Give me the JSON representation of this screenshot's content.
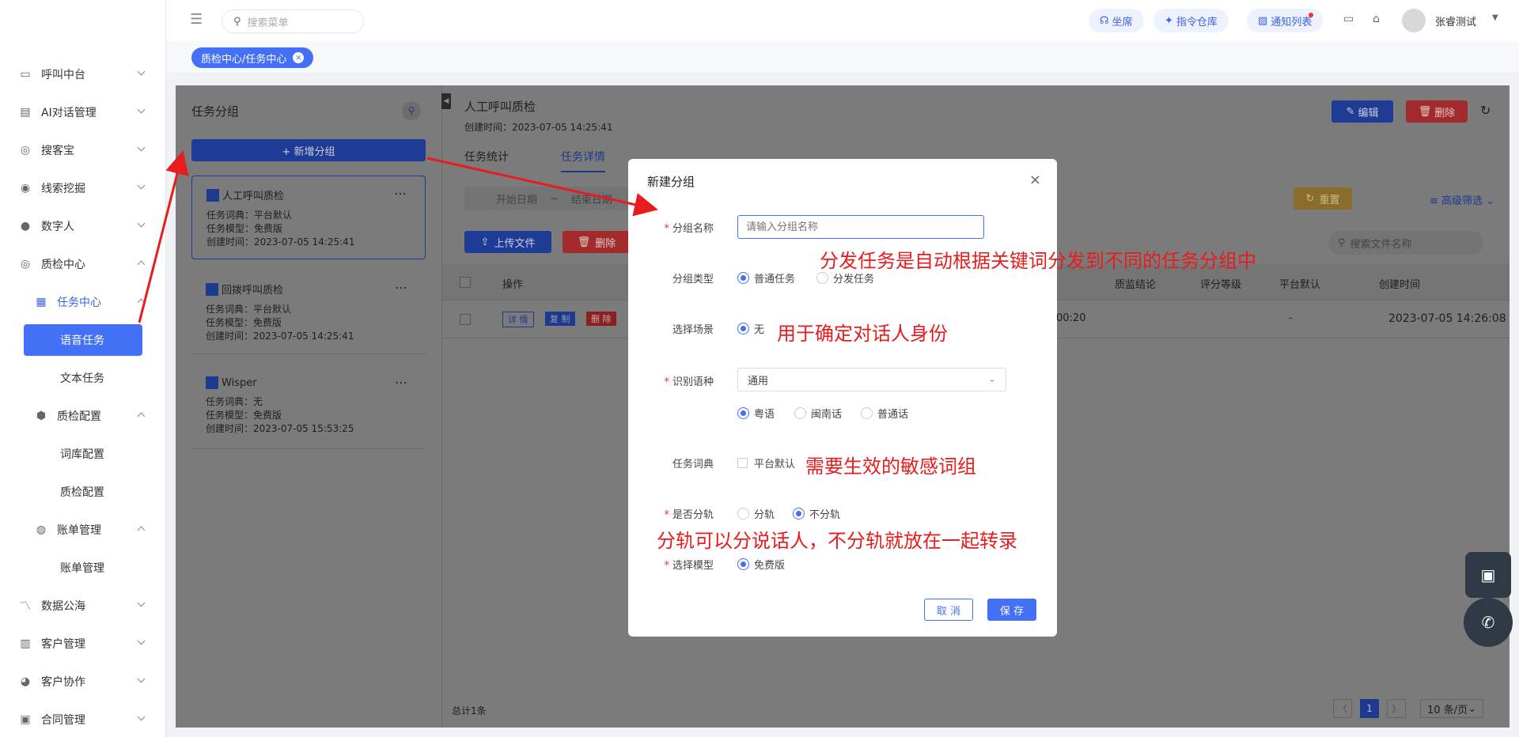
{
  "sidebar": {
    "items": [
      {
        "label": "呼叫中台",
        "icon": "monitor-icon"
      },
      {
        "label": "AI对话管理",
        "icon": "book-icon"
      },
      {
        "label": "搜客宝",
        "icon": "search-circle-icon"
      },
      {
        "label": "线索挖掘",
        "icon": "target-icon"
      },
      {
        "label": "数字人",
        "icon": "person-icon"
      },
      {
        "label": "质检中心",
        "icon": "search-circle-icon"
      },
      {
        "label": "任务中心",
        "icon": "task-icon"
      },
      {
        "label": "语音任务"
      },
      {
        "label": "文本任务"
      },
      {
        "label": "质检配置",
        "icon": "hexagon-icon"
      },
      {
        "label": "词库配置"
      },
      {
        "label": "质检配置"
      },
      {
        "label": "账单管理",
        "icon": "coin-icon"
      },
      {
        "label": "账单管理"
      },
      {
        "label": "数据公海",
        "icon": "chart-icon"
      },
      {
        "label": "客户管理",
        "icon": "customer-icon"
      },
      {
        "label": "客户协作",
        "icon": "collab-icon"
      },
      {
        "label": "合同管理",
        "icon": "contract-icon"
      }
    ]
  },
  "topbar": {
    "search_placeholder": "搜索菜单",
    "seat": "坐席",
    "command_repo": "指令仓库",
    "notify_list": "通知列表",
    "user_name": "张睿测试"
  },
  "tag": {
    "label": "质检中心/任务中心",
    "close": "×"
  },
  "group_panel": {
    "title": "任务分组",
    "add_button": "+ 新增分组",
    "cards": [
      {
        "title": "人工呼叫质检",
        "dict": "任务词典：平台默认",
        "model": "任务模型：免费版",
        "time": "创建时间：2023-07-05 14:25:41"
      },
      {
        "title": "回拨呼叫质检",
        "dict": "任务词典：平台默认",
        "model": "任务模型：免费版",
        "time": "创建时间：2023-07-05 14:25:41"
      },
      {
        "title": "Wisper",
        "dict": "任务词典：无",
        "model": "任务模型：免费版",
        "time": "创建时间：2023-07-05 15:53:25"
      }
    ]
  },
  "detail": {
    "title": "人工呼叫质检",
    "created": "创建时间：2023-07-05 14:25:41",
    "edit": "编辑",
    "delete": "删除",
    "tabs": [
      "任务统计",
      "任务详情"
    ],
    "start_date": "开始日期",
    "tilde": "~",
    "end_date": "结束日期",
    "reset": "重置",
    "advanced": "高级筛选",
    "upload": "上传文件",
    "del": "删除",
    "file_search": "搜索文件名称",
    "columns": [
      "操作",
      "质监结论",
      "评分等级",
      "平台默认",
      "创建时间"
    ],
    "row": {
      "detail": "详 情",
      "copy": "复 制",
      "remove": "删 除",
      "duration": "00:20",
      "default": "-",
      "time": "2023-07-05 14:26:08"
    },
    "total": "总计1条",
    "page": "1",
    "page_size": "10 条/页"
  },
  "modal": {
    "title": "新建分组",
    "close": "×",
    "name_label": "分组名称",
    "name_placeholder": "请输入分组名称",
    "type_label": "分组类型",
    "type_opts": [
      "普通任务",
      "分发任务"
    ],
    "scene_label": "选择场景",
    "scene_opt": "无",
    "lang_label": "识别语种",
    "lang_value": "通用",
    "lang_opts": [
      "粤语",
      "闽南话",
      "普通话"
    ],
    "dict_label": "任务词典",
    "dict_opt": "平台默认",
    "split_label": "是否分轨",
    "split_opts": [
      "分轨",
      "不分轨"
    ],
    "model_label": "选择模型",
    "model_opt": "免费版",
    "cancel": "取 消",
    "save": "保 存"
  },
  "annotations": {
    "a1": "分发任务是自动根据关键词分发到不同的任务分组中",
    "a2": "用于确定对话人身份",
    "a3": "需要生效的敏感词组",
    "a4": "分轨可以分说话人，不分轨就放在一起转录"
  },
  "colors": {
    "accent": "#4470f5",
    "annotation": "#e81c1c",
    "danger": "#e33"
  }
}
